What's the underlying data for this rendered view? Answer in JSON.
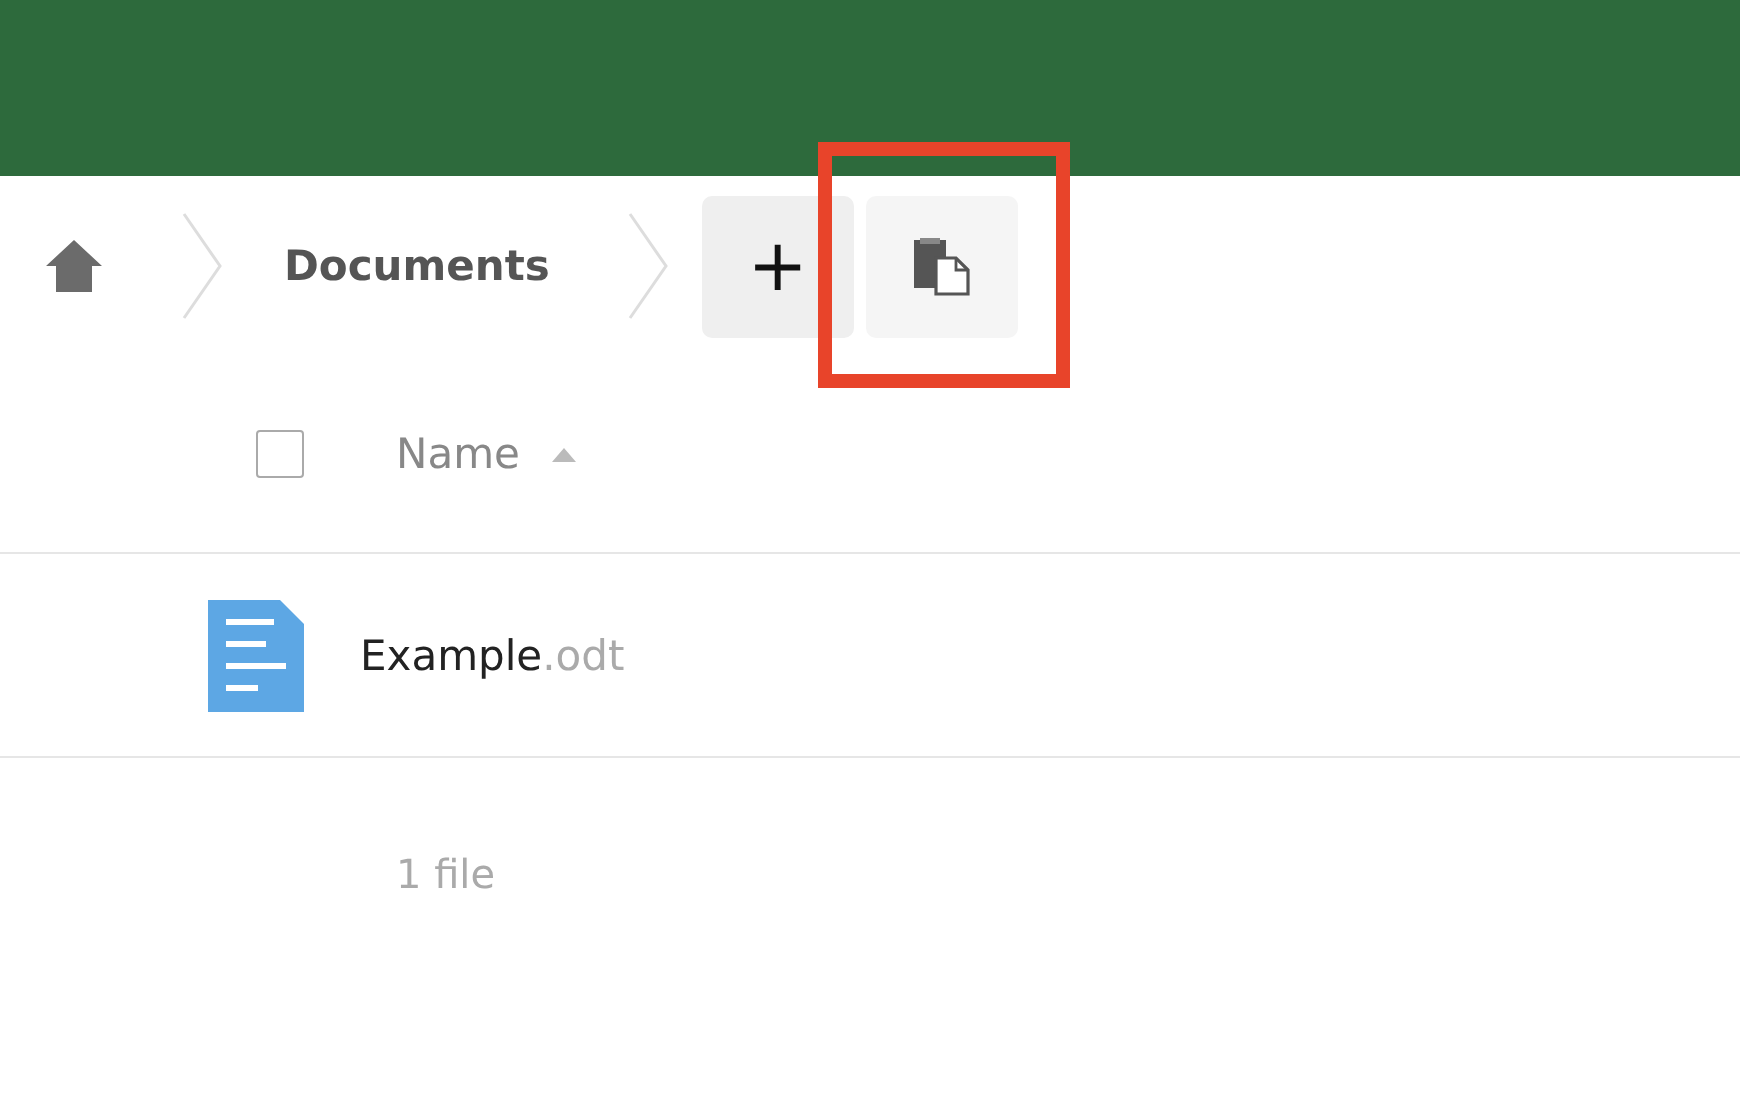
{
  "breadcrumb": {
    "items": [
      {
        "label": "Documents"
      }
    ]
  },
  "actions": [
    {
      "kind": "new",
      "label": "+",
      "highlighted": false
    },
    {
      "kind": "paste",
      "highlighted": true
    }
  ],
  "file_list": {
    "columns": [
      {
        "label": "Name",
        "sort_ascending": true
      }
    ],
    "select_all": {
      "checked": false
    },
    "rows": [
      {
        "name": "Example",
        "extension": ".odt"
      }
    ],
    "summary": "1 file"
  }
}
